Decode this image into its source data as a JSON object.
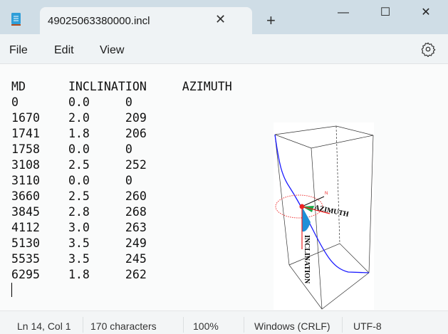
{
  "window": {
    "tab_title": "49025063380000.incl",
    "icon": "notepad-icon"
  },
  "menu": {
    "file": "File",
    "edit": "Edit",
    "view": "View"
  },
  "editor": {
    "content": "MD\tINCLINATION\tAZIMUTH\n0\t0.0\t0\n1670\t2.0\t209\n1741\t1.8\t206\n1758\t0.0\t0\n3108\t2.5\t252\n3110\t0.0\t0\n3660\t2.5\t260\n3845\t2.8\t268\n4112\t3.0\t263\n5130\t3.5\t249\n5535\t3.5\t245\n6295\t1.8\t262"
  },
  "diagram": {
    "azimuth_label": "AZIMUTH",
    "inclination_label": "INCLINATION",
    "north_label": "N"
  },
  "status": {
    "position": "Ln 14, Col 1",
    "characters": "170 characters",
    "zoom": "100%",
    "line_ending": "Windows (CRLF)",
    "encoding": "UTF-8"
  }
}
